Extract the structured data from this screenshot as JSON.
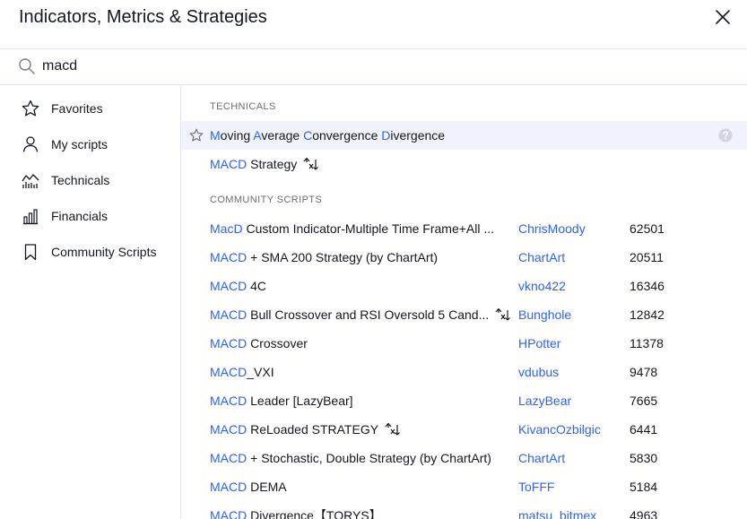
{
  "dialog": {
    "title": "Indicators, Metrics & Strategies"
  },
  "search": {
    "value": "macd"
  },
  "sidebar": {
    "items": [
      {
        "label": "Favorites",
        "icon": "star-icon"
      },
      {
        "label": "My scripts",
        "icon": "user-icon"
      },
      {
        "label": "Technicals",
        "icon": "technicals-chart-icon"
      },
      {
        "label": "Financials",
        "icon": "financials-bar-icon"
      },
      {
        "label": "Community Scripts",
        "icon": "bookmark-icon"
      }
    ]
  },
  "technicals": {
    "heading": "TECHNICALS",
    "rows": [
      {
        "parts": [
          "M",
          "oving ",
          "A",
          "verage ",
          "C",
          "onvergence ",
          "D",
          "ivergence"
        ],
        "highlighted": true
      },
      {
        "parts": [
          "MACD",
          " Strategy"
        ],
        "strategy": true
      }
    ]
  },
  "community": {
    "heading": "COMMUNITY SCRIPTS",
    "rows": [
      {
        "match": "MacD",
        "rest": " Custom Indicator-Multiple Time Frame+All ...",
        "author": "ChrisMoody",
        "count": "62501"
      },
      {
        "match": "MACD",
        "rest": " + SMA 200 Strategy (by ChartArt)",
        "author": "ChartArt",
        "count": "20511"
      },
      {
        "match": "MACD",
        "rest": " 4C",
        "author": "vkno422",
        "count": "16346"
      },
      {
        "match": "MACD",
        "rest": " Bull Crossover and RSI Oversold 5 Cand...",
        "author": "Bunghole",
        "count": "12842",
        "strategy": true
      },
      {
        "match": "MACD",
        "rest": " Crossover",
        "author": "HPotter",
        "count": "11378"
      },
      {
        "match": "MACD",
        "rest": "_VXI",
        "author": "vdubus",
        "count": "9478"
      },
      {
        "match": "MACD",
        "rest": " Leader [LazyBear]",
        "author": "LazyBear",
        "count": "7665"
      },
      {
        "match": "MACD",
        "rest": " ReLoaded STRATEGY",
        "author": "KivancOzbilgic",
        "count": "6441",
        "strategy": true
      },
      {
        "match": "MACD",
        "rest": " + Stochastic, Double Strategy (by ChartArt)",
        "author": "ChartArt",
        "count": "5830"
      },
      {
        "match": "MACD",
        "rest": " DEMA",
        "author": "ToFFF",
        "count": "5184"
      },
      {
        "match": "MACD",
        "rest": " Divergence【TORYS】",
        "author": "matsu_bitmex",
        "count": "4963"
      }
    ]
  },
  "colors": {
    "accent": "#2962ff",
    "text": "#131722",
    "muted": "#6a6d78",
    "highlight_row": "#f0f3fa",
    "border": "#e0e3eb"
  }
}
